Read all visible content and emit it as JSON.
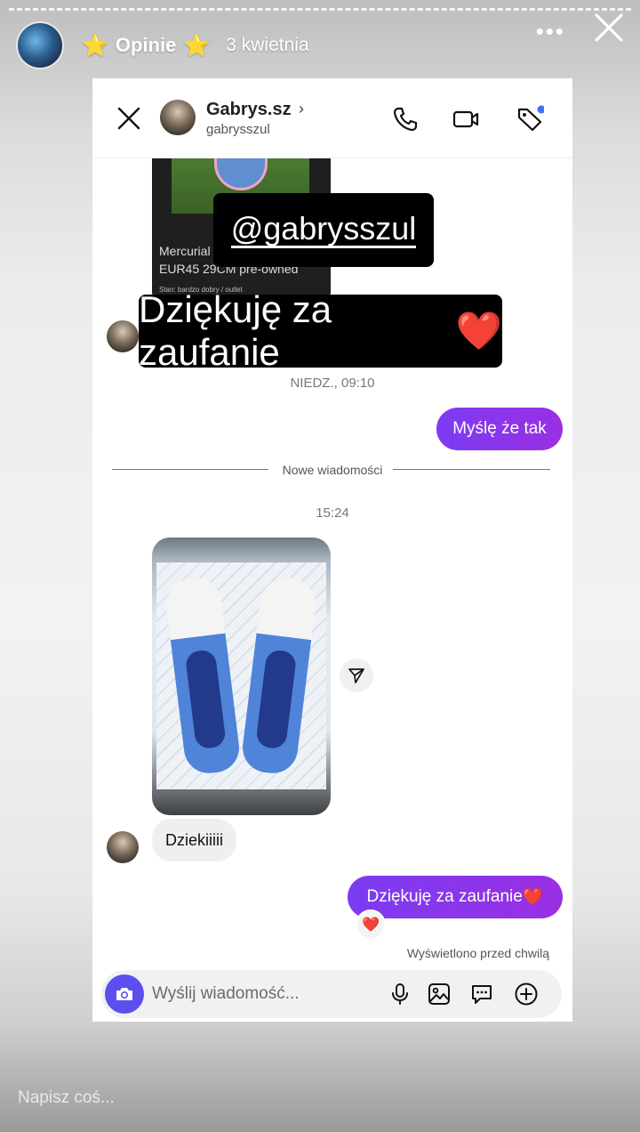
{
  "story": {
    "title": "Opinie",
    "star_left": "⭐",
    "star_right": "⭐",
    "date": "3 kwietnia",
    "more": "•••",
    "reply_placeholder": "Napisz coś..."
  },
  "chat": {
    "contact_name": "Gabrys.sz",
    "contact_user": "gabrysszul",
    "product_card": {
      "line1": "Mercurial",
      "line2": "EUR45 29CM pre-owned",
      "line3": "Stan: bardzo dobry / outlet"
    },
    "sticker_mention": "@gabrysszul",
    "sticker_thanks": "Dziękuję za zaufanie",
    "sticker_heart": "❤️",
    "timestamp1": "NIEDZ., 09:10",
    "msg_out1": "Myślę że tak",
    "divider": "Nowe wiadomości",
    "timestamp2": "15:24",
    "msg_in1": "Dziekiiiii",
    "msg_out2": "Dziękuję za zaufanie",
    "msg_out2_heart": "❤️",
    "reaction": "❤️",
    "seen": "Wyświetlono przed chwilą",
    "composer_placeholder": "Wyślij wiadomość..."
  },
  "colors": {
    "outgoing_bubble": "#8a2be2",
    "camera_button": "#5b4ff0",
    "heart": "#e6202b",
    "notification_dot": "#4a6cf7"
  },
  "icons": {
    "story_close": "close-icon",
    "chat_close": "close-icon",
    "call": "phone-icon",
    "video": "video-camera-icon",
    "tag": "tag-icon",
    "share": "send-icon",
    "camera": "camera-icon",
    "mic": "microphone-icon",
    "gallery": "image-icon",
    "sticker": "chat-bubble-icon",
    "add": "plus-circle-icon"
  }
}
